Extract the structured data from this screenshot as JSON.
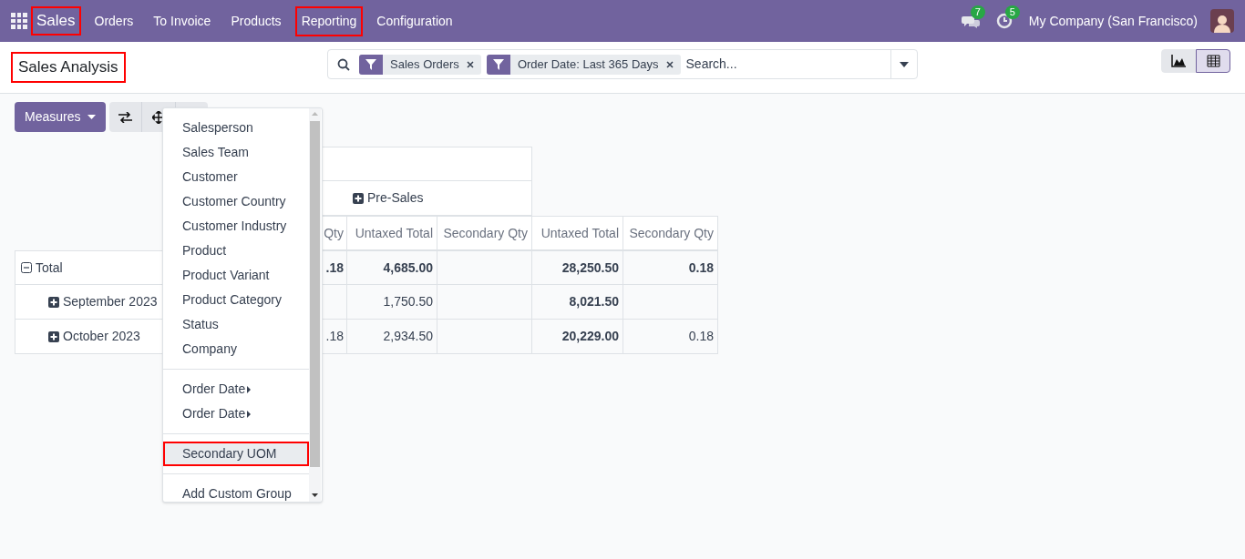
{
  "navbar": {
    "app": {
      "label": "Sales",
      "highlighted": true
    },
    "menus": [
      {
        "label": "Orders",
        "highlighted": false
      },
      {
        "label": "To Invoice",
        "highlighted": false
      },
      {
        "label": "Products",
        "highlighted": false
      },
      {
        "label": "Reporting",
        "highlighted": true
      },
      {
        "label": "Configuration",
        "highlighted": false
      }
    ],
    "messages_count": "7",
    "activities_count": "5",
    "company": "My Company (San Francisco)"
  },
  "breadcrumb": {
    "title": "Sales Analysis",
    "highlighted": true
  },
  "search": {
    "facets": [
      {
        "label": "Sales Orders"
      },
      {
        "label": "Order Date: Last 365 Days"
      }
    ],
    "placeholder": "Search..."
  },
  "views": [
    {
      "kind": "graph",
      "selected": false
    },
    {
      "kind": "pivot",
      "selected": true
    }
  ],
  "toolbar": {
    "measures": "Measures"
  },
  "pivot": {
    "column_group": "Pre-Sales",
    "measure_headers": [
      "Qty",
      "Untaxed Total",
      "Secondary Qty",
      "Untaxed Total",
      "Secondary Qty"
    ],
    "rows": [
      {
        "kind": "total",
        "label": "Total",
        "expanded": true,
        "cells": [
          ".18",
          "4,685.00",
          "",
          "28,250.50",
          "0.18"
        ]
      },
      {
        "kind": "group",
        "label": "September 2023",
        "expanded": false,
        "cells": [
          "",
          "1,750.50",
          "",
          "8,021.50",
          ""
        ]
      },
      {
        "kind": "group",
        "label": "October 2023",
        "expanded": false,
        "cells": [
          ".18",
          "2,934.50",
          "",
          "20,229.00",
          "0.18"
        ]
      }
    ]
  },
  "group_by_menu": [
    {
      "kind": "item",
      "label": "Salesperson",
      "highlighted": false
    },
    {
      "kind": "item",
      "label": "Sales Team",
      "highlighted": false
    },
    {
      "kind": "item",
      "label": "Customer",
      "highlighted": false
    },
    {
      "kind": "item",
      "label": "Customer Country",
      "highlighted": false
    },
    {
      "kind": "item",
      "label": "Customer Industry",
      "highlighted": false
    },
    {
      "kind": "item",
      "label": "Product",
      "highlighted": false
    },
    {
      "kind": "item",
      "label": "Product Variant",
      "highlighted": false
    },
    {
      "kind": "item",
      "label": "Product Category",
      "highlighted": false
    },
    {
      "kind": "item",
      "label": "Status",
      "highlighted": false
    },
    {
      "kind": "item",
      "label": "Company",
      "highlighted": false
    },
    {
      "kind": "divider"
    },
    {
      "kind": "submenu",
      "label": "Order Date",
      "highlighted": false
    },
    {
      "kind": "submenu",
      "label": "Order Date",
      "highlighted": false
    },
    {
      "kind": "divider"
    },
    {
      "kind": "item",
      "label": "Secondary UOM",
      "highlighted": true
    },
    {
      "kind": "divider"
    },
    {
      "kind": "custom",
      "label": "Add Custom Group",
      "highlighted": false
    }
  ]
}
